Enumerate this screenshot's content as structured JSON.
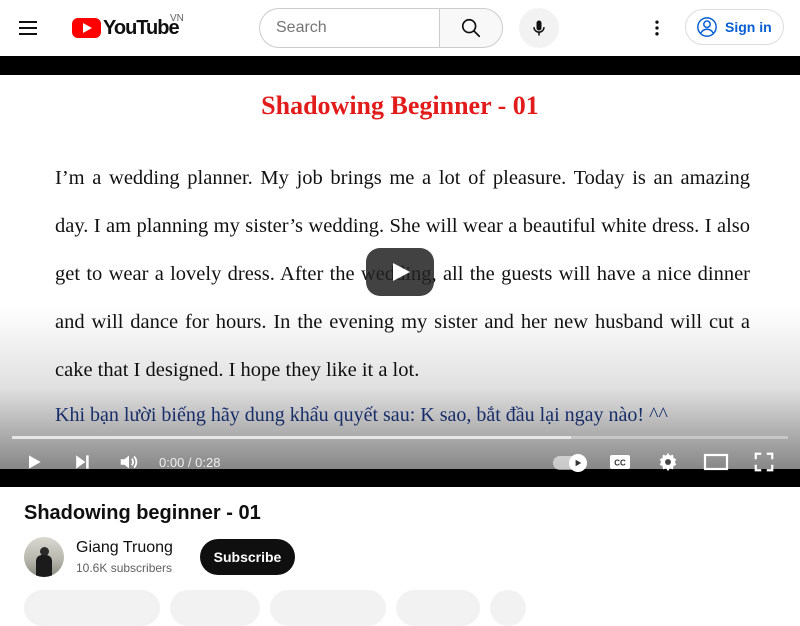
{
  "header": {
    "logo_text": "YouTube",
    "country_code": "VN",
    "search_placeholder": "Search",
    "signin_label": "Sign in",
    "brand_color": "#ff0000",
    "icons": [
      "menu-icon",
      "search-icon",
      "mic-icon",
      "more-vert-icon",
      "account-icon"
    ]
  },
  "video": {
    "slide_title": "Shadowing Beginner - 01",
    "slide_body": "I’m a wedding planner. My job brings me a lot of pleasure. Today is an amazing day. I am planning my sister’s wedding. She will wear a beautiful white dress. I also get to wear a lovely dress. After the wedding, all the guests will have a nice dinner and will dance for hours. In the evening my sister and her new husband will cut a cake that I designed. I hope they like it a lot.",
    "slide_note": "Khi bạn lười biếng hãy dung khẩu quyết sau: K sao, bắt đầu lại ngay nào! ^^",
    "time_display": "0:00 / 0:28",
    "buffered_fraction": 0.72,
    "autoplay_on": true,
    "controls": [
      "play-icon",
      "next-icon",
      "volume-icon",
      "autoplay-toggle",
      "captions-icon",
      "settings-icon",
      "theater-icon",
      "fullscreen-icon"
    ]
  },
  "details": {
    "title": "Shadowing beginner - 01",
    "channel_name": "Giang Truong",
    "subscribers": "10.6K subscribers",
    "subscribe_label": "Subscribe"
  }
}
